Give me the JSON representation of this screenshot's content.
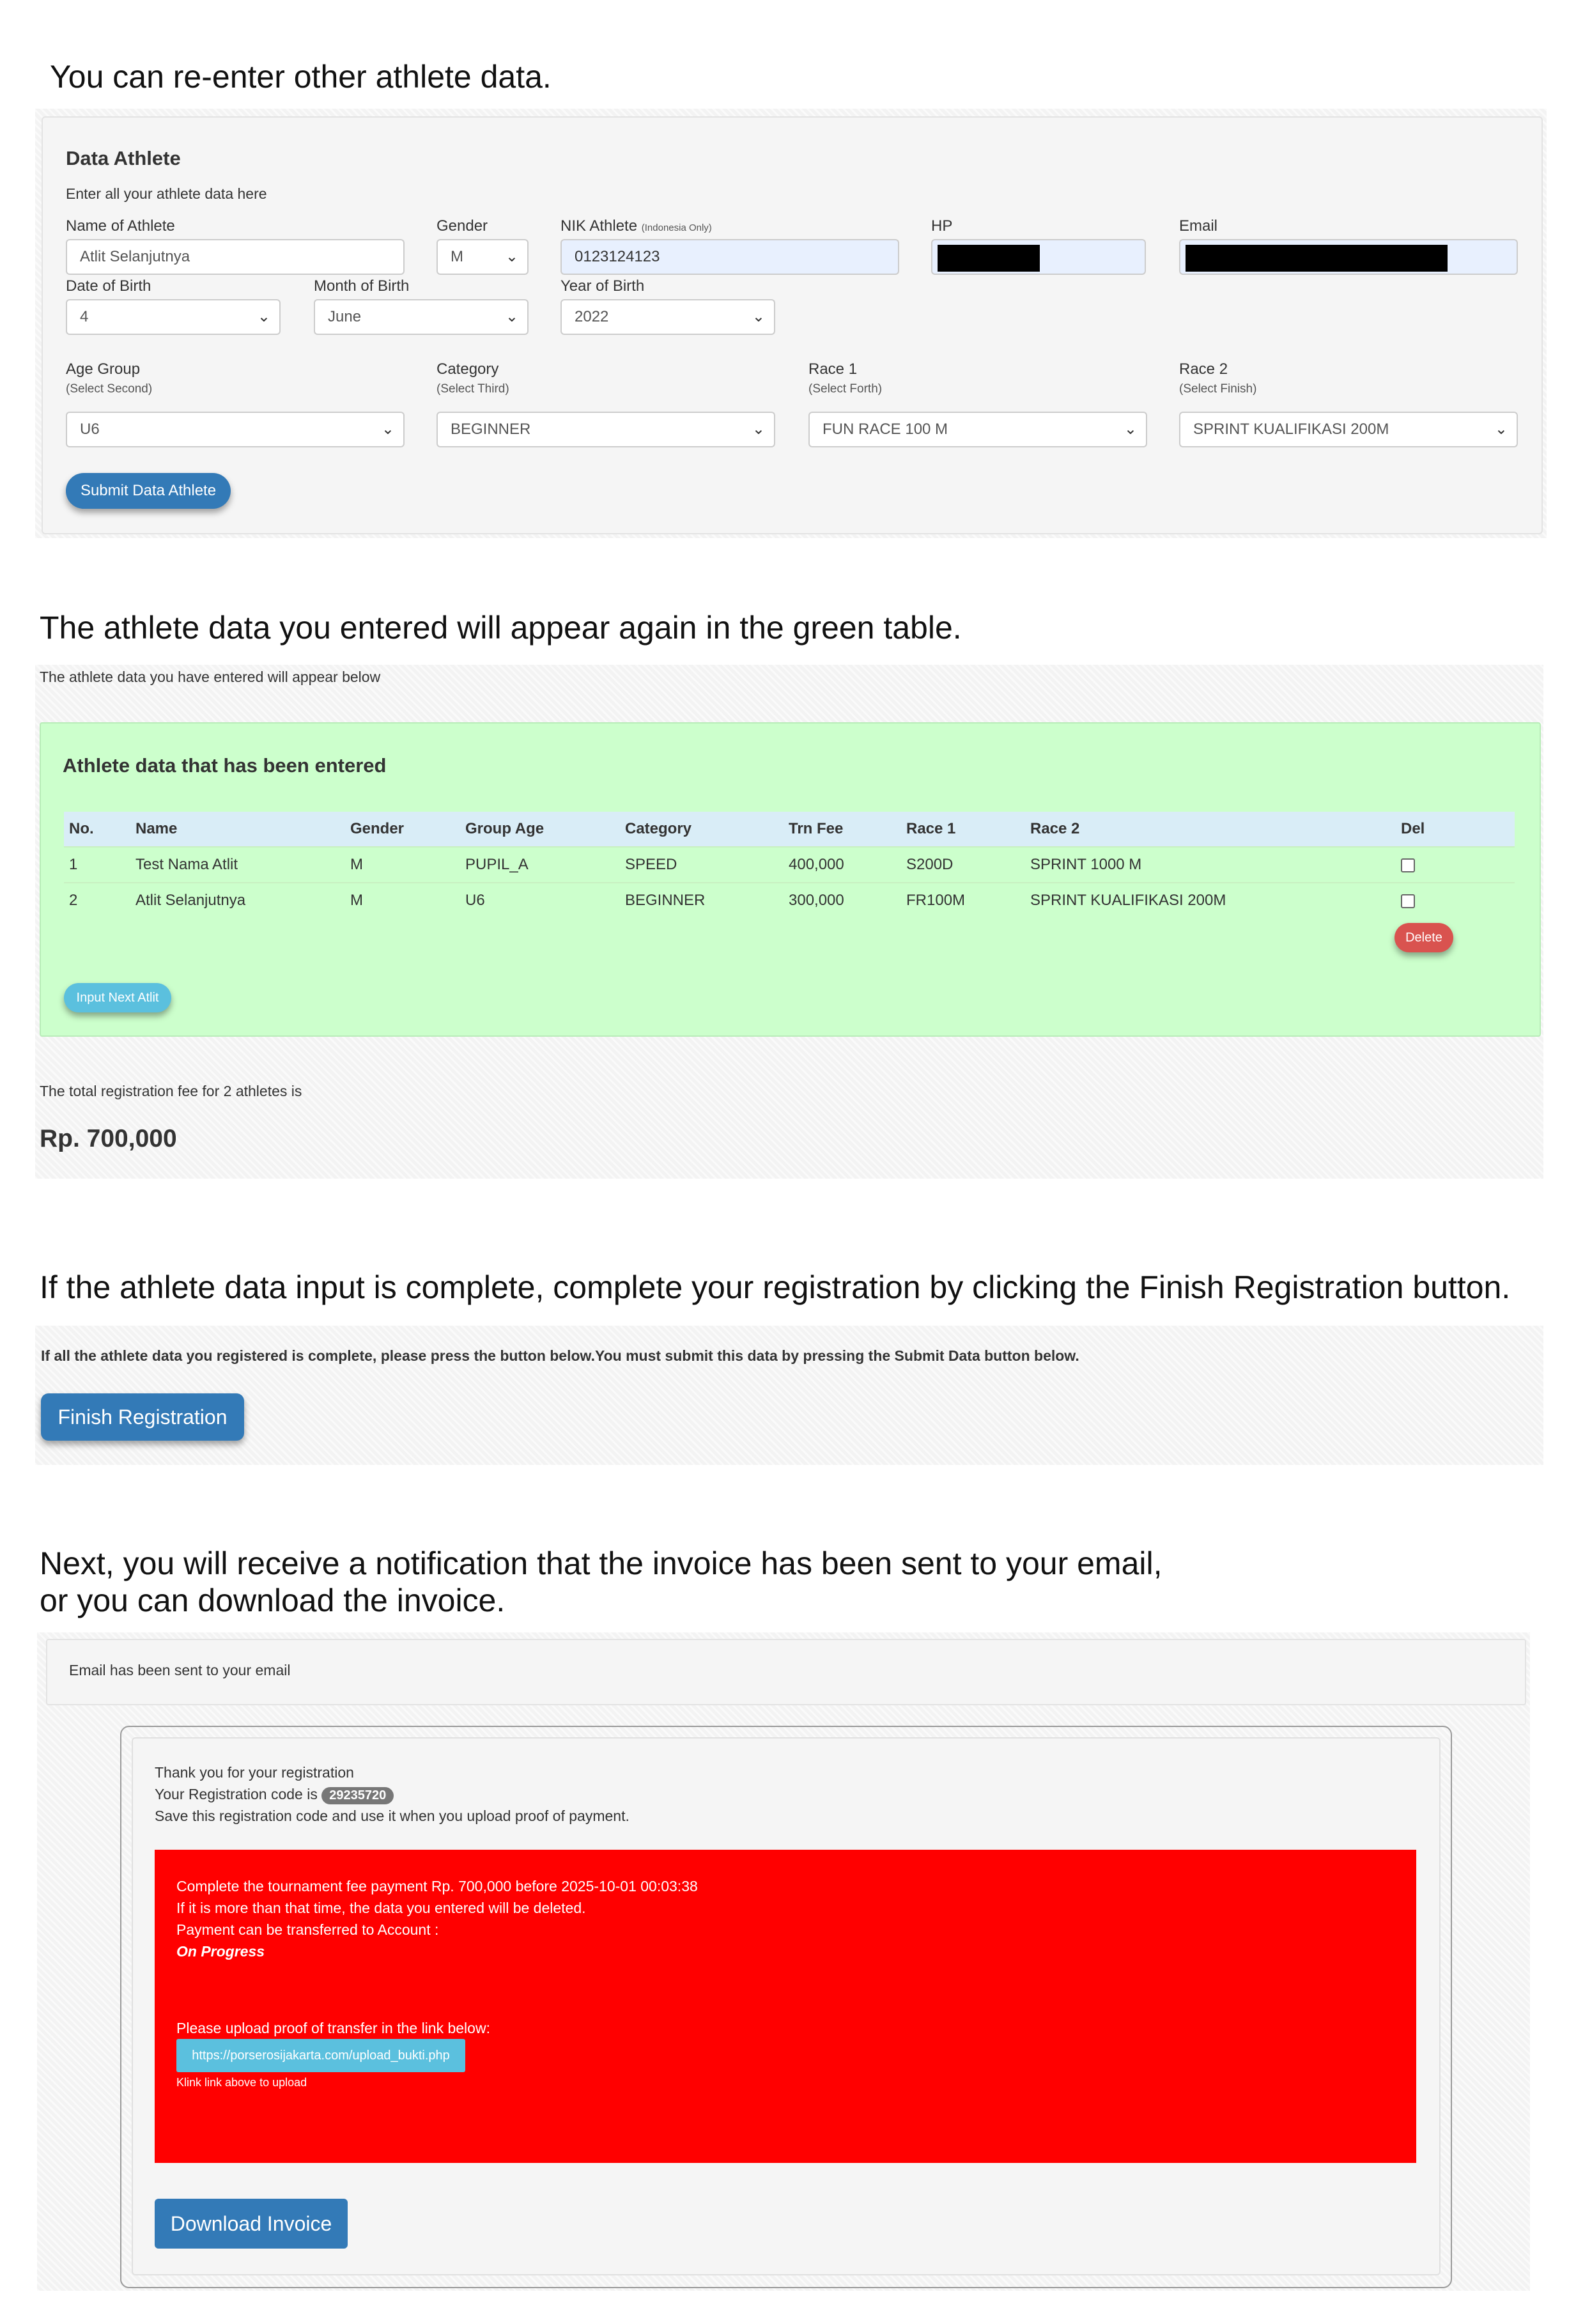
{
  "captions": {
    "step1": "You can re-enter other athlete data.",
    "step2": "The athlete data you entered will appear again in the green table.",
    "step3": "If the athlete data input is complete, complete your registration by clicking the Finish Registration button.",
    "step4_line1": "Next, you will receive a notification that the invoice has been sent to your email,",
    "step4_line2": "or you can download the invoice."
  },
  "form": {
    "title": "Data Athlete",
    "subtitle": "Enter all your athlete data here",
    "name_label": "Name of Athlete",
    "name_value": "Atlit Selanjutnya",
    "gender_label": "Gender",
    "gender_value": "M",
    "nik_label": "NIK Athlete",
    "nik_note": "(Indonesia Only)",
    "nik_value": "0123124123",
    "hp_label": "HP",
    "email_label": "Email",
    "dob_label": "Date of Birth",
    "dob_value": "4",
    "mob_label": "Month of Birth",
    "mob_value": "June",
    "yob_label": "Year of Birth",
    "yob_value": "2022",
    "age_group_label": "Age Group",
    "age_group_note": "(Select Second)",
    "age_group_value": "U6",
    "category_label": "Category",
    "category_note": "(Select Third)",
    "category_value": "BEGINNER",
    "race1_label": "Race 1",
    "race1_note": "(Select Forth)",
    "race1_value": "FUN RACE 100 M",
    "race2_label": "Race 2",
    "race2_note": "(Select Finish)",
    "race2_value": "SPRINT KUALIFIKASI 200M",
    "submit_label": "Submit Data Athlete"
  },
  "table_section": {
    "intro": "The athlete data you have entered will appear below",
    "title": "Athlete data that has been entered",
    "headers": [
      "No.",
      "Name",
      "Gender",
      "Group Age",
      "Category",
      "Trn Fee",
      "Race 1",
      "Race 2",
      "Del"
    ],
    "rows": [
      [
        "1",
        "Test Nama Atlit",
        "M",
        "PUPIL_A",
        "SPEED",
        "400,000",
        "S200D",
        "SPRINT 1000 M"
      ],
      [
        "2",
        "Atlit Selanjutnya",
        "M",
        "U6",
        "BEGINNER",
        "300,000",
        "FR100M",
        "SPRINT KUALIFIKASI 200M"
      ]
    ],
    "delete_label": "Delete",
    "next_label": "Input Next Atlit",
    "total_text": "The total registration fee for 2 athletes is",
    "total_amount": "Rp. 700,000"
  },
  "finish_section": {
    "notice": "If all the athlete data you registered is complete, please press the button below.You must submit this data by pressing the Submit Data button below.",
    "finish_label": "Finish Registration"
  },
  "invoice_section": {
    "email_sent": "Email has been sent to your email",
    "thanks": "Thank you for your registration",
    "code_prefix": "Your Registration code is",
    "code": "29235720",
    "save_note": "Save this registration code and use it when you upload proof of payment.",
    "alert_line1": "Complete the tournament fee payment Rp. 700,000 before 2025-10-01 00:03:38",
    "alert_line2": "If it is more than that time, the data you entered will be deleted.",
    "alert_line3": "Payment can be transferred to Account :",
    "alert_status": "On Progress",
    "upload_prompt": "Please upload proof of transfer in the link below:",
    "upload_link": "https://porserosijakarta.com/upload_bukti.php",
    "upload_hint": "Klink link above to upload",
    "download_label": "Download Invoice"
  },
  "colors": {
    "primary": "#337ab7",
    "info": "#5bc0de",
    "danger": "#d9534f",
    "green_panel": "#ccffcc",
    "alert_red": "#ff0000"
  },
  "icons": {
    "select": "chevron-down-icon",
    "checkbox": "checkbox-icon"
  }
}
